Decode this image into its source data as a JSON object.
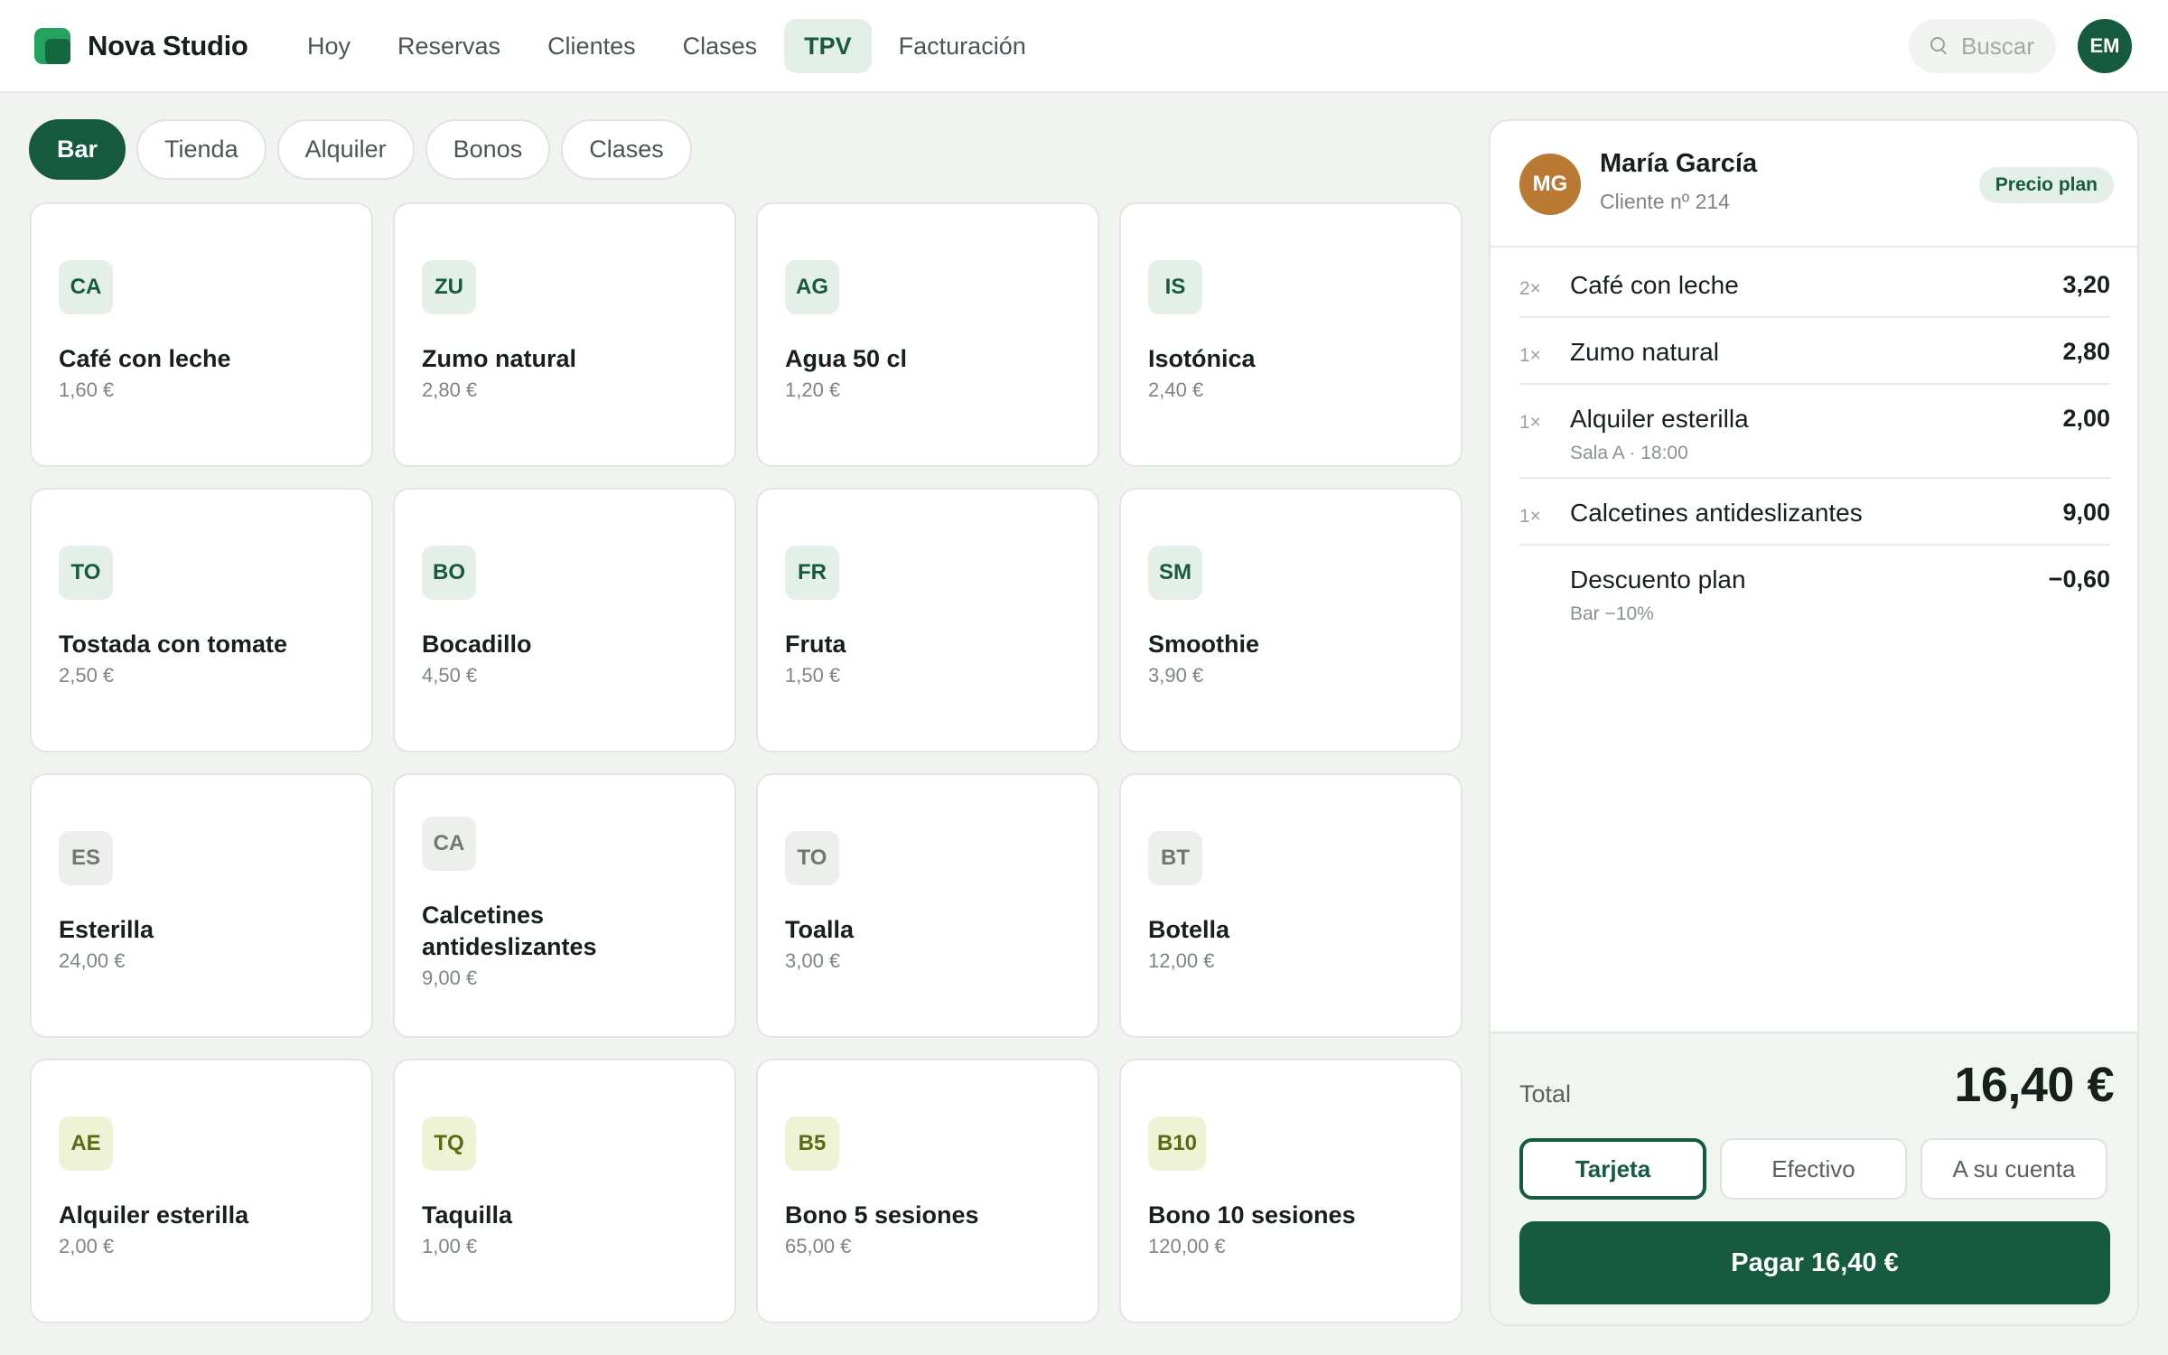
{
  "app": {
    "name": "Nova Studio"
  },
  "nav": {
    "items": [
      {
        "label": "Hoy"
      },
      {
        "label": "Reservas"
      },
      {
        "label": "Clientes"
      },
      {
        "label": "Clases"
      },
      {
        "label": "TPV",
        "active": true
      },
      {
        "label": "Facturación"
      }
    ]
  },
  "search": {
    "placeholder": "Buscar"
  },
  "user": {
    "initials": "EM"
  },
  "categories": [
    {
      "label": "Bar",
      "active": true
    },
    {
      "label": "Tienda"
    },
    {
      "label": "Alquiler"
    },
    {
      "label": "Bonos"
    },
    {
      "label": "Clases"
    }
  ],
  "products": [
    {
      "code": "CA",
      "name": "Café con leche",
      "price": "1,60 €",
      "group": "bar"
    },
    {
      "code": "ZU",
      "name": "Zumo natural",
      "price": "2,80 €",
      "group": "bar"
    },
    {
      "code": "AG",
      "name": "Agua 50 cl",
      "price": "1,20 €",
      "group": "bar"
    },
    {
      "code": "IS",
      "name": "Isotónica",
      "price": "2,40 €",
      "group": "bar"
    },
    {
      "code": "TO",
      "name": "Tostada con tomate",
      "price": "2,50 €",
      "group": "bar"
    },
    {
      "code": "BO",
      "name": "Bocadillo",
      "price": "4,50 €",
      "group": "bar"
    },
    {
      "code": "FR",
      "name": "Fruta",
      "price": "1,50 €",
      "group": "bar"
    },
    {
      "code": "SM",
      "name": "Smoothie",
      "price": "3,90 €",
      "group": "bar"
    },
    {
      "code": "ES",
      "name": "Esterilla",
      "price": "24,00 €",
      "group": "tienda"
    },
    {
      "code": "CA",
      "name": "Calcetines antideslizantes",
      "price": "9,00 €",
      "group": "tienda"
    },
    {
      "code": "TO",
      "name": "Toalla",
      "price": "3,00 €",
      "group": "tienda"
    },
    {
      "code": "BT",
      "name": "Botella",
      "price": "12,00 €",
      "group": "tienda"
    },
    {
      "code": "AE",
      "name": "Alquiler esterilla",
      "price": "2,00 €",
      "group": "bono"
    },
    {
      "code": "TQ",
      "name": "Taquilla",
      "price": "1,00 €",
      "group": "bono"
    },
    {
      "code": "B5",
      "name": "Bono 5 sesiones",
      "price": "65,00 €",
      "group": "bono"
    },
    {
      "code": "B10",
      "name": "Bono 10 sesiones",
      "price": "120,00 €",
      "group": "bono"
    }
  ],
  "customer": {
    "initials": "MG",
    "name": "María García",
    "subtitle": "Cliente nº 214",
    "badge": "Precio plan"
  },
  "ticket": {
    "lines": [
      {
        "qty": "2×",
        "name": "Café con leche",
        "sub": "",
        "amount": "3,20"
      },
      {
        "qty": "1×",
        "name": "Zumo natural",
        "sub": "",
        "amount": "2,80"
      },
      {
        "qty": "1×",
        "name": "Alquiler esterilla",
        "sub": "Sala A · 18:00",
        "amount": "2,00"
      },
      {
        "qty": "1×",
        "name": "Calcetines antideslizantes",
        "sub": "",
        "amount": "9,00"
      },
      {
        "qty": "",
        "name": "Descuento plan",
        "sub": "Bar −10%",
        "amount": "−0,60"
      }
    ],
    "total_label": "Total",
    "total_value": "16,40 €",
    "payment_methods": [
      {
        "label": "Tarjeta",
        "active": true
      },
      {
        "label": "Efectivo"
      },
      {
        "label": "A su cuenta"
      }
    ],
    "pay_button": "Pagar 16,40 €"
  },
  "colors": {
    "brand": "#165a3f",
    "brand_light": "#23a35f",
    "avatar_customer": "#b97933",
    "background": "#f1f3f0"
  }
}
